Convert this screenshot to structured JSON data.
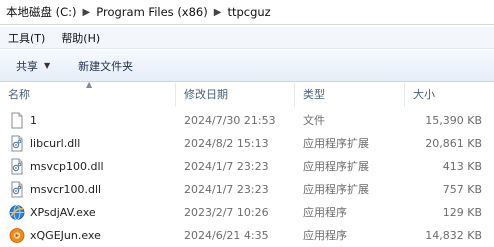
{
  "address": {
    "crumbs": [
      "本地磁盘 (C:)",
      "Program Files (x86)",
      "ttpcguz"
    ]
  },
  "menu": {
    "tools": "工具(T)",
    "help": "帮助(H)"
  },
  "toolbar": {
    "share": "共享",
    "new_folder": "新建文件夹"
  },
  "columns": {
    "name": "名称",
    "modified": "修改日期",
    "type": "类型",
    "size": "大小"
  },
  "files": [
    {
      "name": "1",
      "modified": "2024/7/30 21:53",
      "type": "文件",
      "size": "15,390 KB",
      "icon": "file-icon"
    },
    {
      "name": "libcurl.dll",
      "modified": "2024/8/2 15:13",
      "type": "应用程序扩展",
      "size": "20,861 KB",
      "icon": "dll-icon"
    },
    {
      "name": "msvcp100.dll",
      "modified": "2024/1/7 23:23",
      "type": "应用程序扩展",
      "size": "413 KB",
      "icon": "dll-icon"
    },
    {
      "name": "msvcr100.dll",
      "modified": "2024/1/7 23:23",
      "type": "应用程序扩展",
      "size": "757 KB",
      "icon": "dll-icon"
    },
    {
      "name": "XPsdjAV.exe",
      "modified": "2023/2/7 10:26",
      "type": "应用程序",
      "size": "129 KB",
      "icon": "exe-globe-icon"
    },
    {
      "name": "xQGEJun.exe",
      "modified": "2024/6/21 4:35",
      "type": "应用程序",
      "size": "14,832 KB",
      "icon": "exe-orange-icon"
    }
  ]
}
